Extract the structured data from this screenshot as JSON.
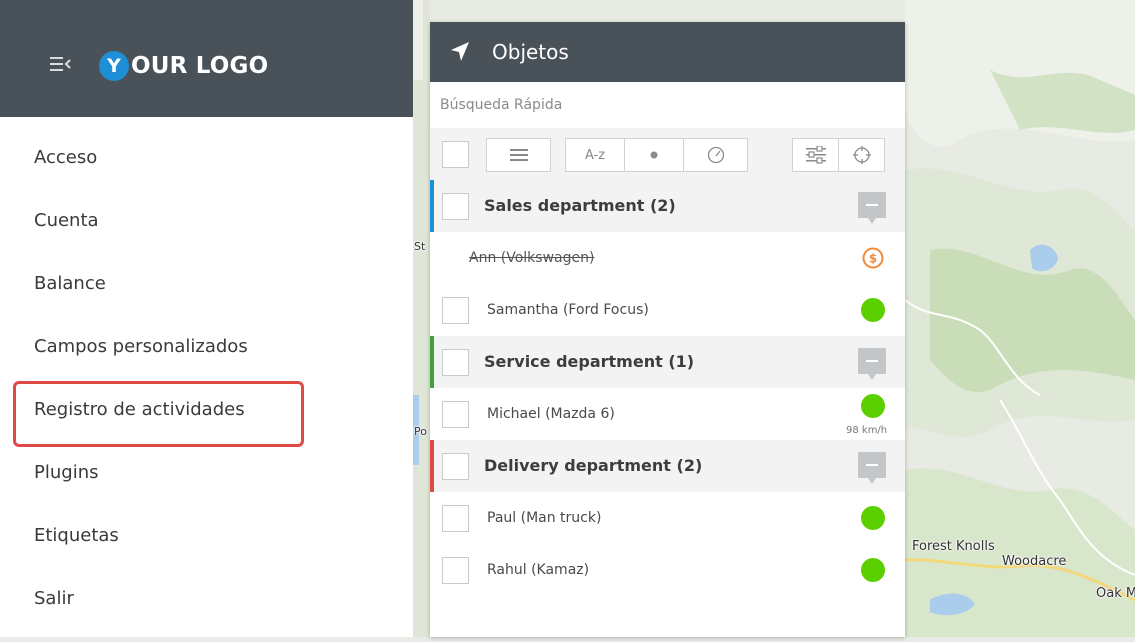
{
  "logo": {
    "letter": "Y",
    "text": "OUR LOGO"
  },
  "menu": [
    {
      "label": "Acceso"
    },
    {
      "label": "Cuenta"
    },
    {
      "label": "Balance"
    },
    {
      "label": "Campos personalizados"
    },
    {
      "label": "Registro de actividades",
      "highlighted": true
    },
    {
      "label": "Plugins"
    },
    {
      "label": "Etiquetas"
    },
    {
      "label": "Salir"
    }
  ],
  "panel": {
    "title": "Objetos",
    "search_placeholder": "Búsqueda Rápida",
    "toolbar": {
      "sort_az_label": "A-z"
    }
  },
  "groups": [
    {
      "name": "Sales department (2)",
      "color": "#1e8fd6",
      "objects": [
        {
          "name": "Ann (Volkswagen)",
          "disabled": true,
          "status": "coin-icon",
          "status_color": "#f08a3a"
        },
        {
          "name": "Samantha (Ford Focus)",
          "status": "online",
          "status_color": "#5ccf00"
        }
      ]
    },
    {
      "name": "Service department (1)",
      "color": "#3fa33f",
      "objects": [
        {
          "name": "Michael (Mazda 6)",
          "status": "online",
          "status_color": "#5ccf00",
          "speed": "98 km/h"
        }
      ]
    },
    {
      "name": "Delivery department (2)",
      "color": "#e04a45",
      "objects": [
        {
          "name": "Paul (Man truck)",
          "status": "online",
          "status_color": "#5ccf00"
        },
        {
          "name": "Rahul (Kamaz)",
          "status": "online",
          "status_color": "#5ccf00"
        }
      ]
    }
  ],
  "map": {
    "labels": [
      "Forest Knolls",
      "Woodacre",
      "Oak M",
      "Po",
      "St"
    ]
  },
  "colors": {
    "header": "#4a5259",
    "accent": "#1e8fd6",
    "online": "#5ccf00",
    "highlight": "#e04a45"
  }
}
